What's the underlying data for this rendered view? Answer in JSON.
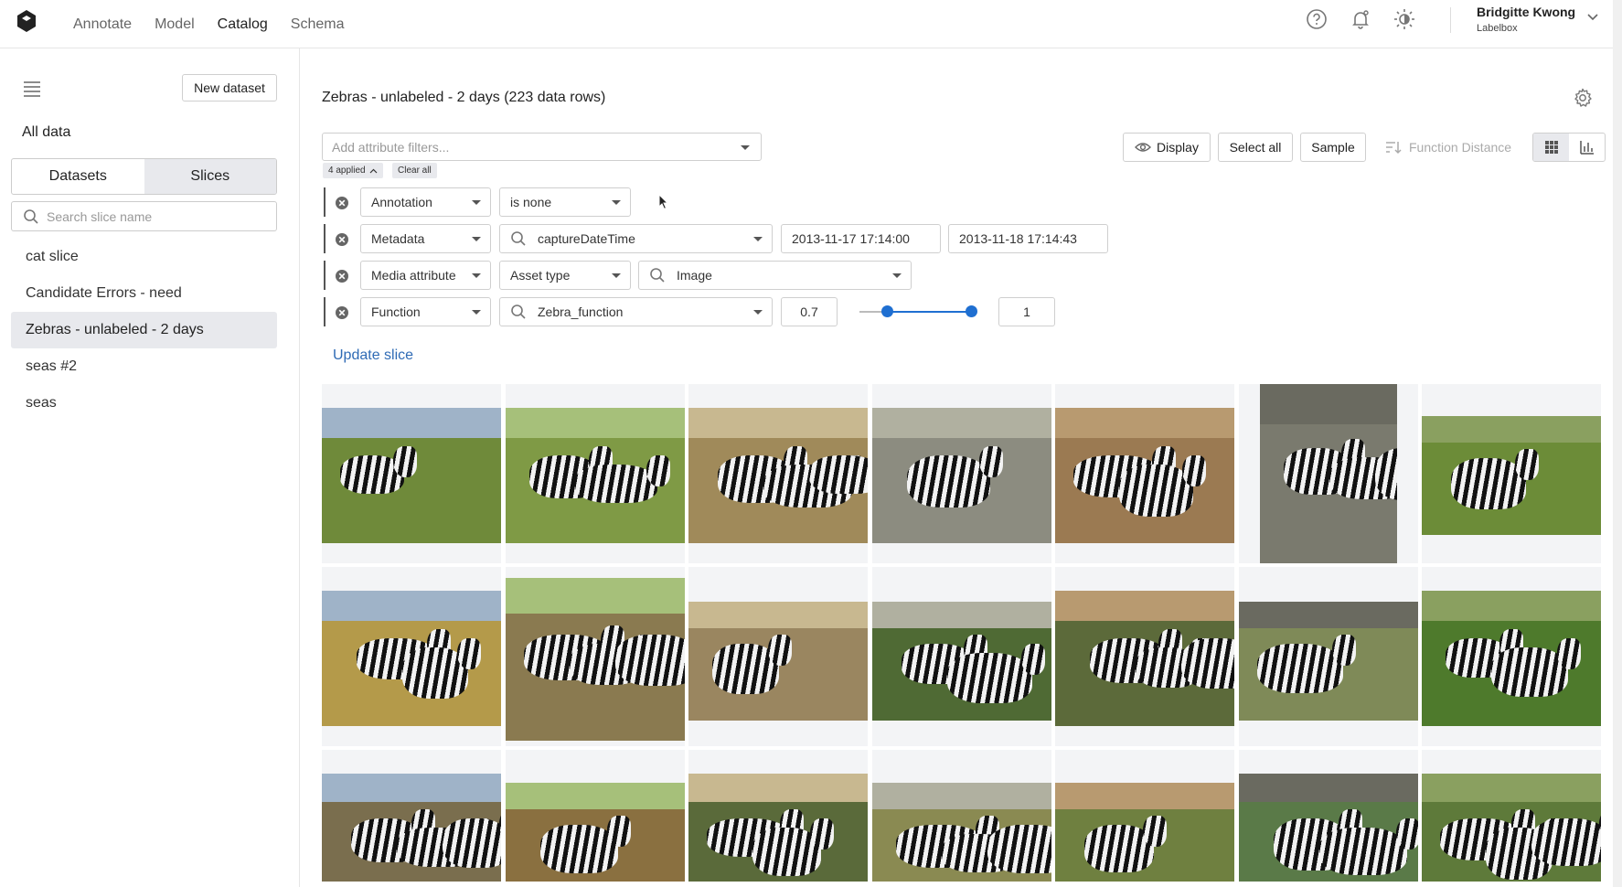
{
  "nav": {
    "items": [
      "Annotate",
      "Model",
      "Catalog",
      "Schema"
    ],
    "active": "Catalog"
  },
  "top_icons": [
    "help-icon",
    "bell-icon",
    "theme-icon"
  ],
  "user": {
    "name": "Bridgitte Kwong",
    "org": "Labelbox"
  },
  "sidebar": {
    "new_dataset": "New dataset",
    "all_data": "All data",
    "tabs": [
      "Datasets",
      "Slices"
    ],
    "active_tab": "Slices",
    "search_placeholder": "Search slice name",
    "slices": [
      "cat slice",
      "Candidate Errors - need",
      "Zebras - unlabeled - 2 days",
      "seas #2",
      "seas"
    ],
    "selected_slice": "Zebras - unlabeled - 2 days"
  },
  "main": {
    "title": "Zebras - unlabeled - 2 days (223 data rows)",
    "filter_placeholder": "Add attribute filters...",
    "applied": "4 applied",
    "clear_all": "Clear all",
    "toolbar": {
      "display": "Display",
      "select_all": "Select all",
      "sample": "Sample",
      "function_distance": "Function Distance"
    },
    "filters": [
      {
        "attribute": "Annotation",
        "operator": "is none"
      },
      {
        "attribute": "Metadata",
        "field": "captureDateTime",
        "from": "2013-11-17 17:14:00",
        "to": "2013-11-18 17:14:43"
      },
      {
        "attribute": "Media attribute",
        "field": "Asset type",
        "value": "Image"
      },
      {
        "attribute": "Function",
        "field": "Zebra_function",
        "min": "0.7",
        "max": "1",
        "range_low": 0.7,
        "range_high": 1.0
      }
    ],
    "update_slice": "Update slice"
  },
  "colors": {
    "accent": "#1f6fd1",
    "link": "#2f6bb5",
    "selected_bg": "#e8e9ed"
  }
}
